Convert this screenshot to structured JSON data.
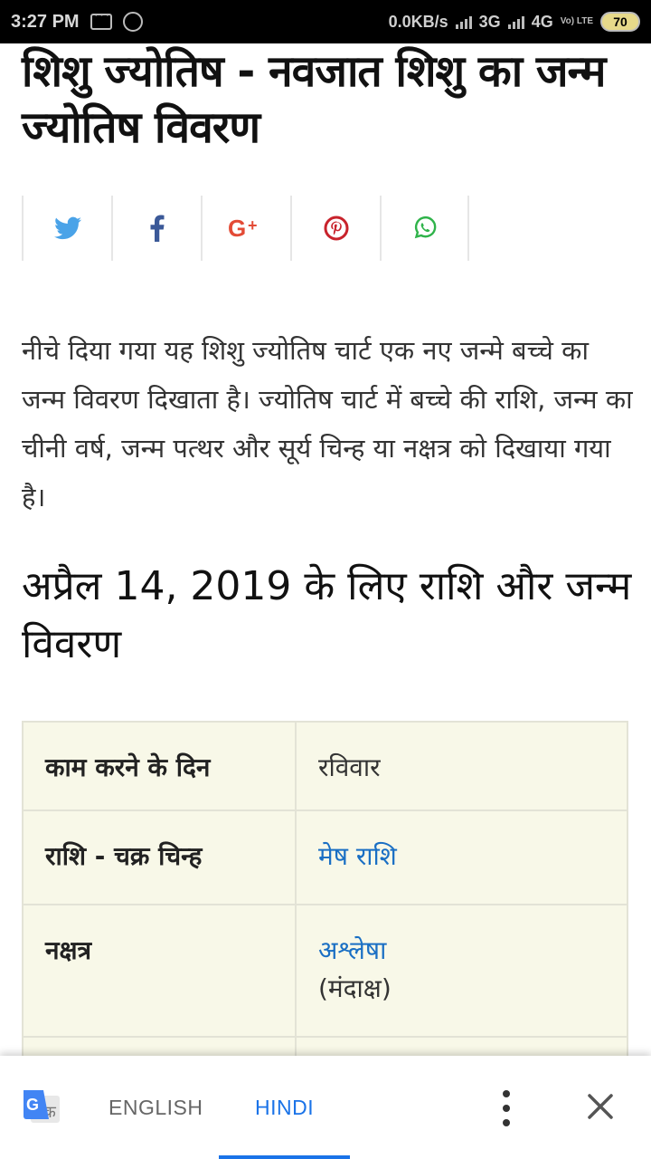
{
  "status_bar": {
    "time": "3:27 PM",
    "network_speed": "0.0KB/s",
    "net1": "3G",
    "net2": "4G",
    "battery": "70",
    "volte": "Vo) LTE"
  },
  "article": {
    "title": "शिशु ज्योतिष - नवजात शिशु का जन्म ज्योतिष विवरण",
    "share_icons": [
      "twitter-icon",
      "facebook-icon",
      "google-plus-icon",
      "pinterest-icon",
      "whatsapp-icon"
    ],
    "intro": "नीचे दिया गया यह शिशु ज्योतिष चार्ट एक नए जन्मे बच्चे का जन्म विवरण दिखाता है। ज्योतिष चार्ट में बच्चे की राशि, जन्म का चीनी वर्ष, जन्म पत्थर और सूर्य चिन्ह या नक्षत्र को दिखाया गया है।",
    "section_heading": "अप्रैल 14, 2019 के लिए राशि और जन्म विवरण"
  },
  "details": {
    "rows": [
      {
        "label": "काम करने के दिन",
        "value": "रविवार"
      },
      {
        "label": "राशि - चक्र चिन्ह",
        "value": "मेष राशि"
      },
      {
        "label": "नक्षत्र",
        "value": "अश्लेषा",
        "note": "(मंदाक्ष)"
      }
    ]
  },
  "translate_bar": {
    "source_lang": "ENGLISH",
    "target_lang": "HINDI"
  },
  "colors": {
    "link": "#1a6fc4",
    "active_tab": "#1a73e8",
    "table_bg": "#f8f8e8"
  }
}
